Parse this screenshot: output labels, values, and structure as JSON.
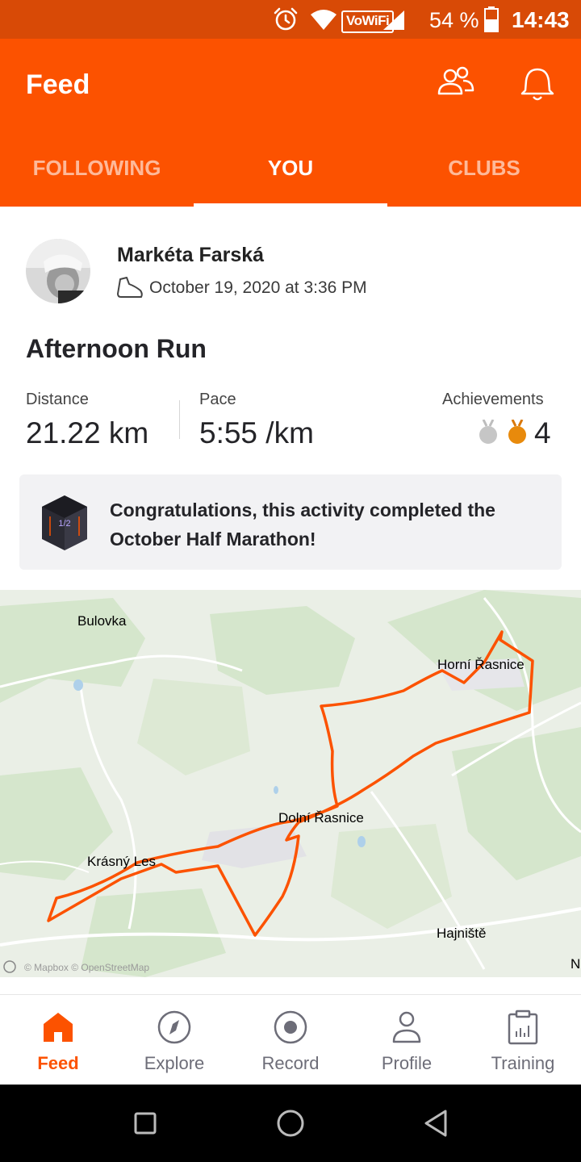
{
  "status_bar": {
    "vowifi": "VoWiFi",
    "battery": "54 %",
    "time": "14:43"
  },
  "header": {
    "title": "Feed",
    "tabs": [
      {
        "label": "FOLLOWING",
        "active": false
      },
      {
        "label": "YOU",
        "active": true
      },
      {
        "label": "CLUBS",
        "active": false
      }
    ]
  },
  "activity": {
    "athlete": "Markéta Farská",
    "activity_icon": "shoe-icon",
    "date": "October 19, 2020 at 3:36 PM",
    "title": "Afternoon Run",
    "stats": {
      "distance_label": "Distance",
      "distance_value": "21.22 km",
      "pace_label": "Pace",
      "pace_value": "5:55 /km",
      "achievements_label": "Achievements",
      "achievements_count": "4"
    },
    "challenge": {
      "badge_text": "1/2",
      "message": "Congratulations, this activity completed the October Half Marathon!"
    },
    "map": {
      "labels": [
        "Bulovka",
        "Horní Řasnice",
        "Dolní Řasnice",
        "Krásný Les",
        "Hajniště",
        "N"
      ],
      "attribution": "© Mapbox © OpenStreetMap",
      "route_color": "#fc5200"
    }
  },
  "bottom_nav": [
    {
      "label": "Feed",
      "icon": "home-icon",
      "active": true
    },
    {
      "label": "Explore",
      "icon": "compass-icon",
      "active": false
    },
    {
      "label": "Record",
      "icon": "record-icon",
      "active": false
    },
    {
      "label": "Profile",
      "icon": "profile-icon",
      "active": false
    },
    {
      "label": "Training",
      "icon": "training-icon",
      "active": false
    }
  ],
  "colors": {
    "brand": "#fc5200",
    "status_bar": "#d84a06"
  }
}
